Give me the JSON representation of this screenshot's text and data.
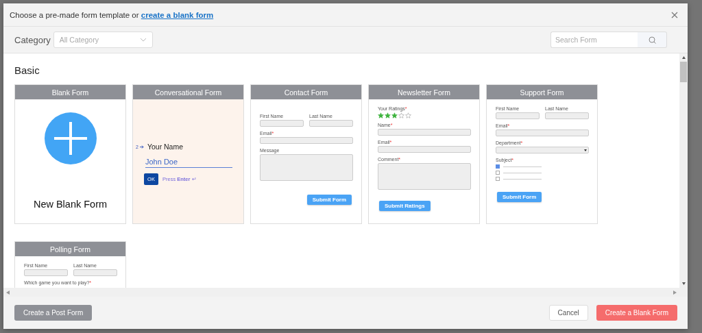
{
  "dialog": {
    "title": "Choose a pre-made form template or ",
    "title_link": "create a blank form"
  },
  "filter": {
    "category_label": "Category",
    "category_placeholder": "All Category",
    "search_placeholder": "Search Form"
  },
  "sections": [
    {
      "title": "Basic",
      "cards": [
        {
          "title": "Blank Form",
          "kind": "blank",
          "text": "New Blank Form"
        },
        {
          "title": "Conversational Form",
          "kind": "conversational",
          "number": "2",
          "question": "Your Name",
          "value": "John Doe",
          "button": "OK",
          "hint": "Press **Enter** ↵"
        },
        {
          "title": "Contact Form",
          "kind": "fields",
          "fields": [
            {
              "kind": "pair",
              "labels": [
                "First Name",
                "Last Name"
              ]
            },
            {
              "kind": "input",
              "label": "Email",
              "mark": "*"
            },
            {
              "kind": "textarea",
              "label": "Message"
            },
            {
              "kind": "submit",
              "label": "Submit Form",
              "right_aligned": true
            }
          ]
        },
        {
          "title": "Newsletter Form",
          "kind": "fields",
          "fields": [
            {
              "kind": "stars",
              "label": "Your Ratings",
              "mark": "*",
              "stars": 3
            },
            {
              "kind": "input",
              "label": "Name",
              "mark": "*"
            },
            {
              "kind": "input",
              "label": "Email",
              "mark": "*"
            },
            {
              "kind": "textarea",
              "label": "Comment",
              "mark": "*"
            },
            {
              "kind": "submit",
              "label": "Submit Ratings",
              "right_aligned": false
            }
          ]
        },
        {
          "title": "Support Form",
          "kind": "fields",
          "fields": [
            {
              "kind": "pair",
              "labels": [
                "First Name",
                "Last Name"
              ]
            },
            {
              "kind": "input",
              "label": "Email",
              "mark": "*"
            },
            {
              "kind": "select",
              "label": "Department",
              "mark": "*"
            },
            {
              "kind": "checks",
              "label": "Subject",
              "mark": "*",
              "options": [
                {
                  "checked": true
                },
                {
                  "checked": false
                },
                {
                  "checked": false
                }
              ]
            },
            {
              "kind": "submit",
              "label": "Submit Form",
              "right_aligned": false
            }
          ]
        },
        {
          "title": "Polling Form",
          "kind": "fields",
          "fields": [
            {
              "kind": "pair",
              "labels": [
                "First Name",
                "Last Name"
              ]
            },
            {
              "kind": "text",
              "label": "Which game you want to play?",
              "mark": "*"
            }
          ]
        }
      ]
    }
  ],
  "footer": {
    "post_button": "Create a Post Form",
    "cancel_button": "Cancel",
    "blank_button": "Create a Blank Form"
  }
}
